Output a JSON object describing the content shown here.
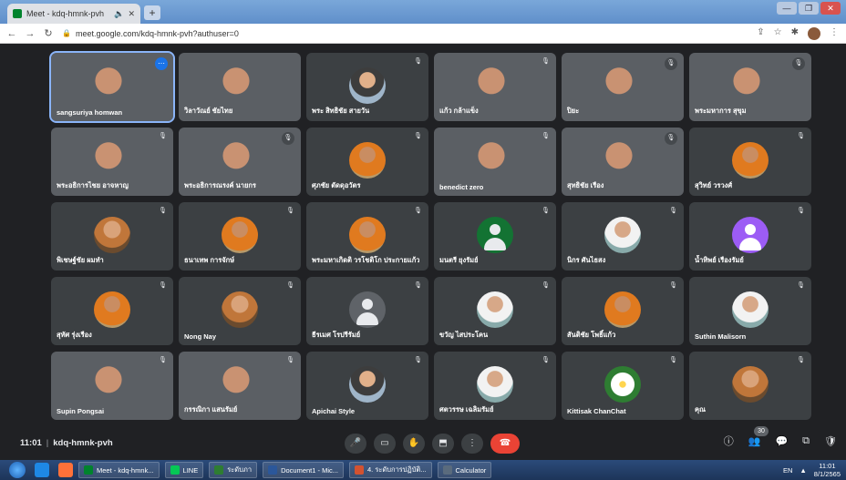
{
  "browser": {
    "tab_title": "Meet - kdq-hmnk-pvh",
    "tab_audio": "🔈",
    "tab_close": "✕",
    "new_tab": "+",
    "url": "meet.google.com/kdq-hmnk-pvh?authuser=0",
    "window_controls": [
      "—",
      "❐",
      "✕"
    ]
  },
  "participants": [
    {
      "name": "sangsuriya homwan",
      "style": "video",
      "bg": "vb1",
      "mic": "more"
    },
    {
      "name": "วิลาวัณย์ ชัยไทย",
      "style": "video",
      "bg": "vb2",
      "mic": ""
    },
    {
      "name": "พระ สิทธิชัย สายวัน",
      "style": "avatar",
      "avatar": "photo2",
      "mic": "muted"
    },
    {
      "name": "แก้ว กล้าแข็ง",
      "style": "video",
      "bg": "vb3",
      "mic": "muted"
    },
    {
      "name": "ปิยะ",
      "style": "video",
      "bg": "vb4",
      "mic": "badge"
    },
    {
      "name": "พระมหาการ สุขุม",
      "style": "video",
      "bg": "vb5",
      "mic": "badge"
    },
    {
      "name": "พระอธิการไชย อาจหาญ",
      "style": "video",
      "bg": "vb6",
      "mic": "muted"
    },
    {
      "name": "พระอธิการณรงค์ นายกร",
      "style": "video",
      "bg": "vb7",
      "mic": "badge"
    },
    {
      "name": "ศุภชัย ตัดดุอวัตร",
      "style": "avatar",
      "avatar": "photo3",
      "mic": "muted"
    },
    {
      "name": "benedict zero",
      "style": "video",
      "bg": "vb8",
      "mic": "muted"
    },
    {
      "name": "สุทธิชัย เรือง",
      "style": "video",
      "bg": "vb9",
      "mic": "badge"
    },
    {
      "name": "สุวิทย์ วรวงศ์",
      "style": "avatar",
      "avatar": "photo3",
      "mic": "muted"
    },
    {
      "name": "พิเชษฐ์ชัย ผมทำ",
      "style": "avatar",
      "avatar": "photo",
      "mic": "muted"
    },
    {
      "name": "ธนาเทพ การจักษ์",
      "style": "avatar",
      "avatar": "photo3",
      "mic": "muted"
    },
    {
      "name": "พระมหาเกิดติ วรโชติโก ประกายแก้ว",
      "style": "avatar",
      "avatar": "photo3",
      "mic": "muted"
    },
    {
      "name": "มนตรี ยุงรัมย์",
      "style": "avatar",
      "avatar": "green",
      "mic": "muted"
    },
    {
      "name": "นิกร ศันไธสง",
      "style": "avatar",
      "avatar": "photo4",
      "mic": "muted"
    },
    {
      "name": "น้ำทิพย์ เรืองรัมย์",
      "style": "avatar",
      "avatar": "purple",
      "mic": "muted"
    },
    {
      "name": "สุทัศ รุ่งเรือง",
      "style": "avatar",
      "avatar": "photo3",
      "mic": "muted"
    },
    {
      "name": "Nong Nay",
      "style": "avatar",
      "avatar": "photo",
      "mic": "muted"
    },
    {
      "name": "ธีรเมศ โรปรีรัมย์",
      "style": "avatar",
      "avatar": "gray",
      "mic": "muted"
    },
    {
      "name": "ขวัญ ไสประโคน",
      "style": "avatar",
      "avatar": "photo4",
      "mic": "muted"
    },
    {
      "name": "สันติชัย โพธิ์แก้ว",
      "style": "avatar",
      "avatar": "photo3",
      "mic": "muted"
    },
    {
      "name": "Suthin Malisorn",
      "style": "avatar",
      "avatar": "photo4",
      "mic": "muted"
    },
    {
      "name": "Supin Pongsai",
      "style": "video",
      "bg": "vb10",
      "mic": "muted"
    },
    {
      "name": "กรรณิกา แสนรัมย์",
      "style": "video",
      "bg": "vb11",
      "mic": "muted"
    },
    {
      "name": "Apichai Style",
      "style": "avatar",
      "avatar": "photo2",
      "mic": "muted"
    },
    {
      "name": "ศตวรรษ เฉลิมรัมย์",
      "style": "avatar",
      "avatar": "photo4",
      "mic": "muted"
    },
    {
      "name": "Kittisak ChanChat",
      "style": "avatar",
      "avatar": "flower",
      "mic": "muted"
    },
    {
      "name": "คุณ",
      "style": "avatar",
      "avatar": "photo",
      "mic": "muted"
    }
  ],
  "meeting": {
    "time": "11:01",
    "separator": "|",
    "code": "kdq-hmnk-pvh",
    "participant_count": "30"
  },
  "controls": {
    "mic": "🎤",
    "camera": "▭",
    "raise_hand": "✋",
    "present": "⬒",
    "more": "⋮",
    "end_call": "☎"
  },
  "right_controls": {
    "info": "ⓘ",
    "people": "👥",
    "chat": "💬",
    "activities": "⧉",
    "host": "🛡"
  },
  "taskbar": {
    "buttons": [
      {
        "label": "Meet - kdq-hmnk...",
        "color": "#00832d"
      },
      {
        "label": "LINE",
        "color": "#06c755"
      },
      {
        "label": "ระดับภา",
        "color": "#2e7d32"
      },
      {
        "label": "Document1 - Mic...",
        "color": "#2b579a"
      },
      {
        "label": "4. ระดับการปฏิบัติ...",
        "color": "#d35230"
      },
      {
        "label": "Calculator",
        "color": "#5a6b7d"
      }
    ],
    "lang": "EN",
    "clock_time": "11:01",
    "clock_date": "8/1/2565"
  }
}
